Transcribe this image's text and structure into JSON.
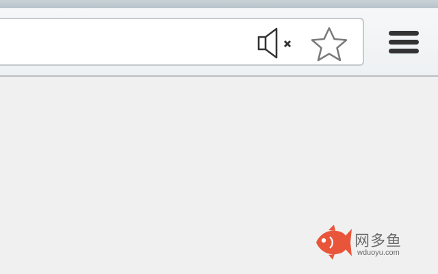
{
  "toolbar": {
    "address_value": "",
    "address_placeholder": "",
    "icons": {
      "mute": "speaker-muted-icon",
      "bookmark": "star-outline-icon",
      "menu": "hamburger-menu-icon"
    }
  },
  "watermark": {
    "logo": "fish-logo-icon",
    "title": "网多鱼",
    "url": "wduoyu.com",
    "accent_color": "#e8553a",
    "text_color": "#6a6a6a"
  },
  "colors": {
    "background": "#f0f0f0",
    "toolbar": "#f4f5f6",
    "icon": "#333333",
    "star_outline": "#7a7a7a"
  }
}
